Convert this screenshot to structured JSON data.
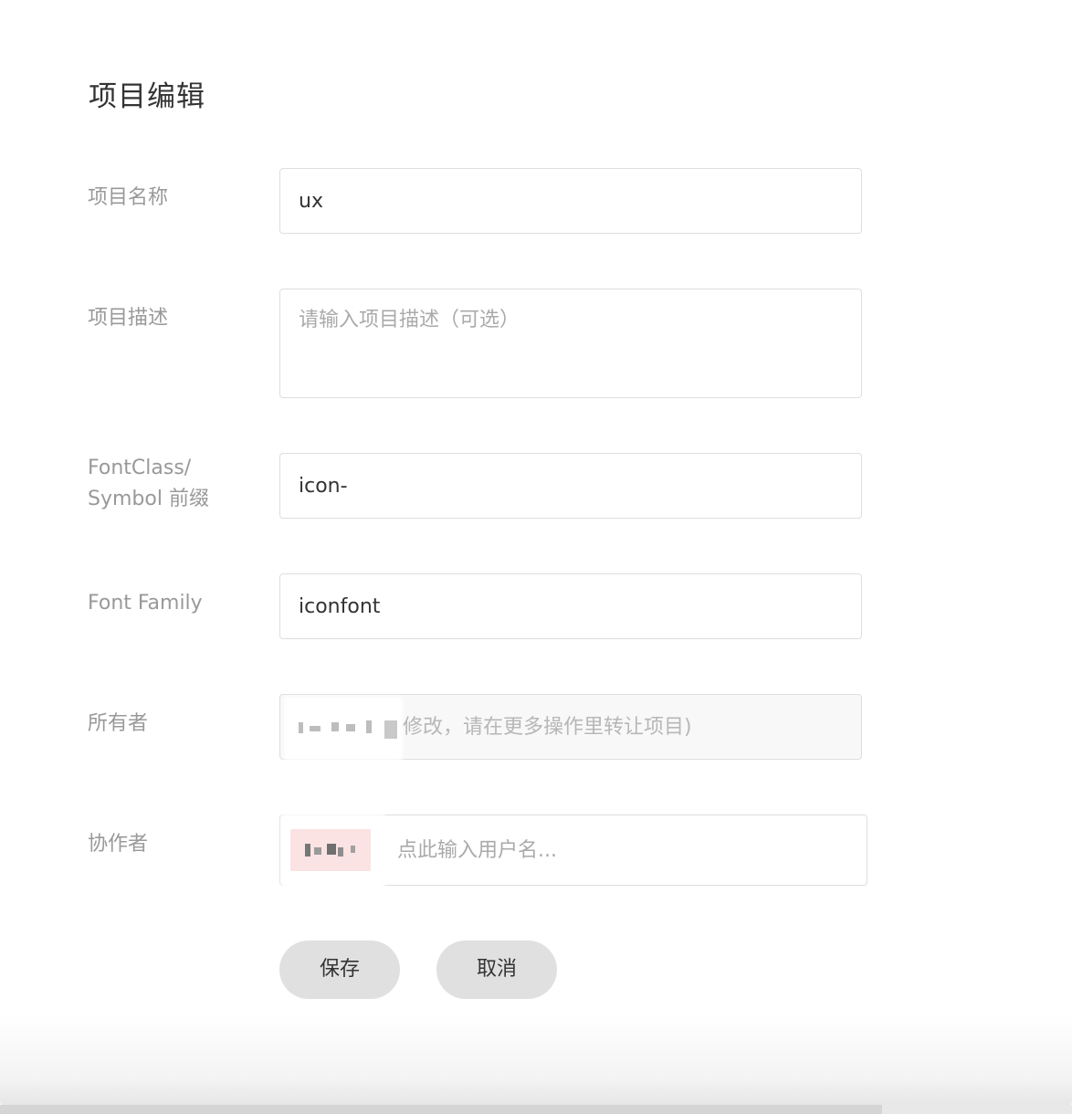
{
  "dialog": {
    "title": "项目编辑"
  },
  "fields": {
    "name": {
      "label": "项目名称",
      "value": "ux"
    },
    "description": {
      "label": "项目描述",
      "placeholder": "请输入项目描述（可选）"
    },
    "prefix": {
      "label_line1": "FontClass/",
      "label_line2": "Symbol 前缀",
      "value": "icon-"
    },
    "font_family": {
      "label": "Font Family",
      "value": "iconfont"
    },
    "owner": {
      "label": "所有者",
      "note": "修改，请在更多操作里转让项目)"
    },
    "collaborators": {
      "label": "协作者",
      "placeholder": "点此输入用户名..."
    }
  },
  "buttons": {
    "save": "保存",
    "cancel": "取消"
  },
  "colors": {
    "label": "#999999",
    "text": "#333333",
    "button_bg": "#e0e0e0",
    "tag_bg": "#fbe3e3"
  }
}
